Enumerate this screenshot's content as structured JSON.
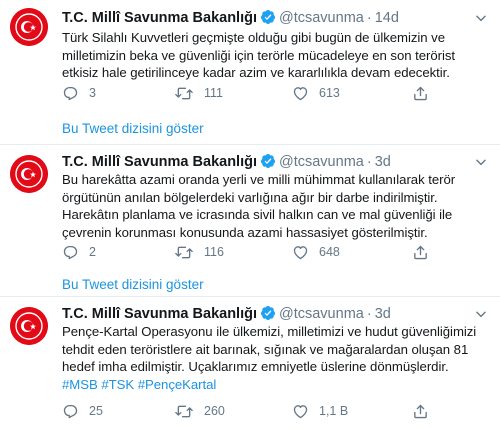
{
  "tweets": [
    {
      "author": "T.C. Millî Savunma Bakanlığı",
      "handle": "@tcsavunma",
      "separator": "·",
      "time": "14d",
      "text": "Türk Silahlı Kuvvetleri geçmişte olduğu gibi bugün de ülkemizin ve milletimizin beka ve güvenliği için terörle mücadeleye en son terörist etkisiz hale getirilinceye kadar azim ve kararlılıkla devam edecektir.",
      "replies": "3",
      "retweets": "111",
      "likes": "613",
      "thread_link": "Bu Tweet dizisini göster"
    },
    {
      "author": "T.C. Millî Savunma Bakanlığı",
      "handle": "@tcsavunma",
      "separator": "·",
      "time": "3d",
      "text": "Bu harekâtta azami oranda yerli ve milli mühimmat kullanılarak terör örgütünün anılan bölgelerdeki varlığına ağır bir darbe indirilmiştir. Harekâtın planlama ve icrasında sivil halkın can ve mal güvenliği ile çevrenin korunması konusunda azami hassasiyet gösterilmiştir.",
      "replies": "2",
      "retweets": "116",
      "likes": "648",
      "thread_link": "Bu Tweet dizisini göster"
    },
    {
      "author": "T.C. Millî Savunma Bakanlığı",
      "handle": "@tcsavunma",
      "separator": "·",
      "time": "3d",
      "text": "Pençe-Kartal Operasyonu ile ülkemizi, milletimizi ve hudut güvenliğimizi tehdit eden teröristlere ait barınak, sığınak ve mağaralardan oluşan 81 hedef imha edilmiştir. Uçaklarımız emniyetle üslerine dönmüşlerdir.",
      "hashtags": "#MSB #TSK #PençeKartal",
      "replies": "25",
      "retweets": "260",
      "likes": "1,1 B"
    }
  ],
  "colors": {
    "accent": "#1b95e0",
    "verified": "#1da1f2",
    "muted": "#657786",
    "avatar_red": "#e30a17",
    "divider": "#e6ecf0"
  },
  "icons": [
    "verified-badge-icon",
    "chevron-down-icon",
    "reply-icon",
    "retweet-icon",
    "like-icon",
    "share-icon",
    "emblem-icon"
  ]
}
